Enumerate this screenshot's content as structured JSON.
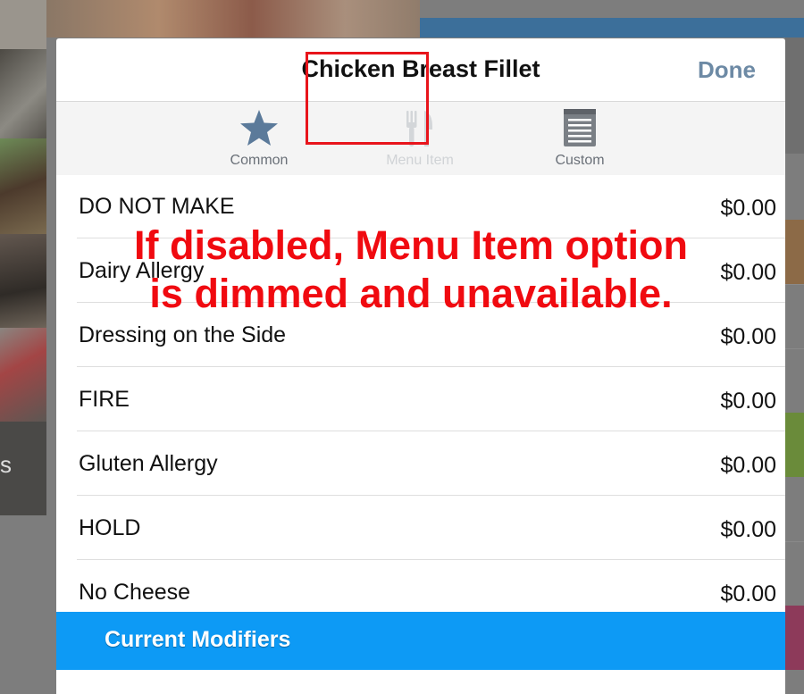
{
  "modal": {
    "title": "Chicken Breast Fillet",
    "done_label": "Done"
  },
  "tabs": [
    {
      "label": "Common",
      "icon": "star-icon",
      "state": "normal"
    },
    {
      "label": "Menu Item",
      "icon": "fork-knife-icon",
      "state": "disabled"
    },
    {
      "label": "Custom",
      "icon": "notepad-icon",
      "state": "normal"
    }
  ],
  "modifiers": [
    {
      "name": "DO NOT MAKE",
      "price": "$0.00"
    },
    {
      "name": "Dairy Allergy",
      "price": "$0.00"
    },
    {
      "name": "Dressing on the Side",
      "price": "$0.00"
    },
    {
      "name": "FIRE",
      "price": "$0.00"
    },
    {
      "name": "Gluten Allergy",
      "price": "$0.00"
    },
    {
      "name": "HOLD",
      "price": "$0.00"
    },
    {
      "name": "No Cheese",
      "price": "$0.00"
    }
  ],
  "current_modifiers": {
    "label": "Current Modifiers"
  },
  "annotation": {
    "line1": "If disabled, Menu Item option",
    "line2": "is dimmed and unavailable."
  },
  "background": {
    "edge_glyph": "s"
  },
  "colors": {
    "accent_blue": "#0d9af5",
    "done_text": "#6d8aa5",
    "annotation_red": "#f00a10",
    "icon_blue": "#5b7a9a"
  }
}
